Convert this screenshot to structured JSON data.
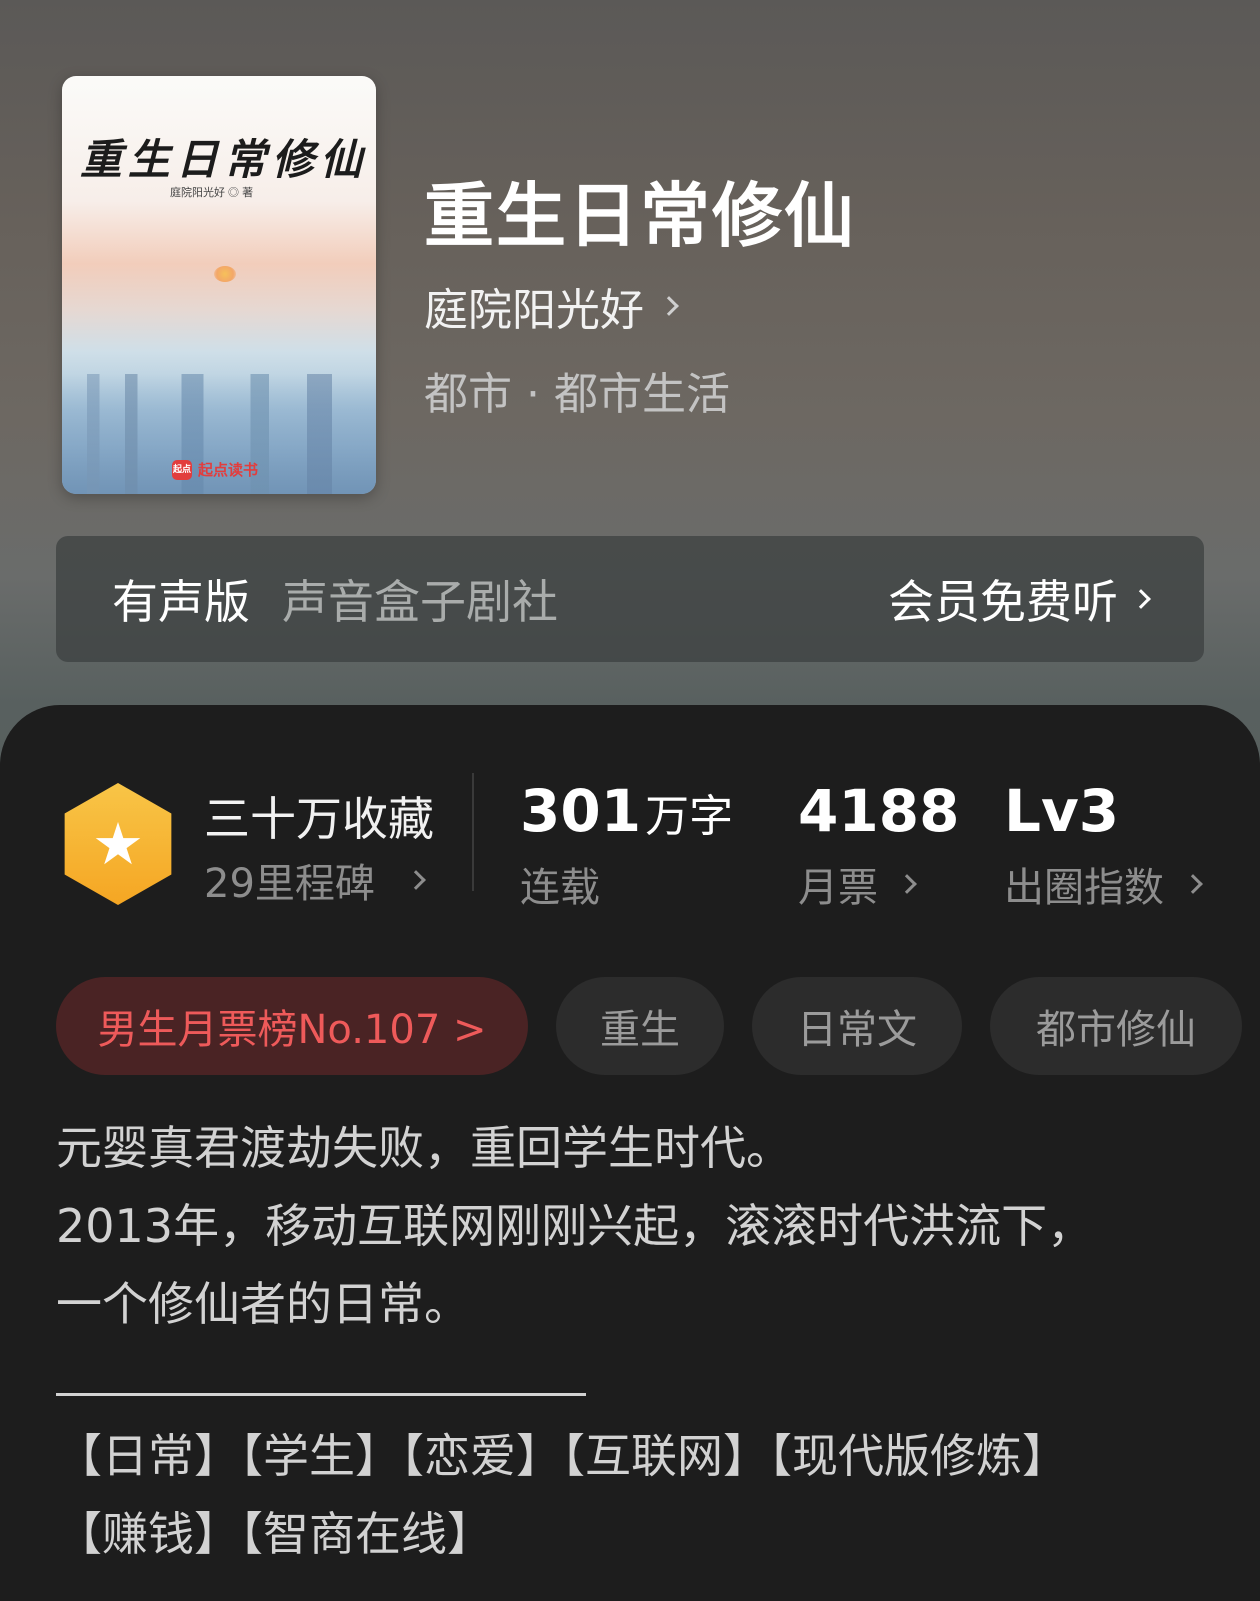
{
  "book": {
    "cover": {
      "title": "重生日常修仙",
      "author_line": "庭院阳光好 ◎ 著",
      "publisher": "起点读书",
      "publisher_mark": "起点"
    },
    "title": "重生日常修仙",
    "author": "庭院阳光好",
    "genre": "都市 · 都市生活"
  },
  "audio": {
    "label": "有声版",
    "studio": "声音盒子剧社",
    "cta": "会员免费听"
  },
  "stats": {
    "collect_title": "三十万收藏",
    "collect_sub": "29里程碑",
    "words_num": "301",
    "words_unit": "万字",
    "words_label": "连载",
    "votes_num": "4188",
    "votes_label": "月票",
    "level_num": "Lv3",
    "level_label": "出圈指数"
  },
  "tags": [
    "男生月票榜No.107 >",
    "重生",
    "日常文",
    "都市修仙"
  ],
  "description": {
    "lines": [
      "元婴真君渡劫失败，重回学生时代。",
      "2013年，移动互联网刚刚兴起，滚滚时代洪流下，",
      "一个修仙者的日常。"
    ],
    "tag_lines": [
      "【日常】【学生】【恋爱】【互联网】【现代版修炼】",
      "【赚钱】【智商在线】"
    ]
  },
  "colors": {
    "panel_bg": "#1d1d1d",
    "badge_gold": "#f5a623",
    "rank_red": "#ee5a5a",
    "rank_bg": "#4a2324"
  }
}
